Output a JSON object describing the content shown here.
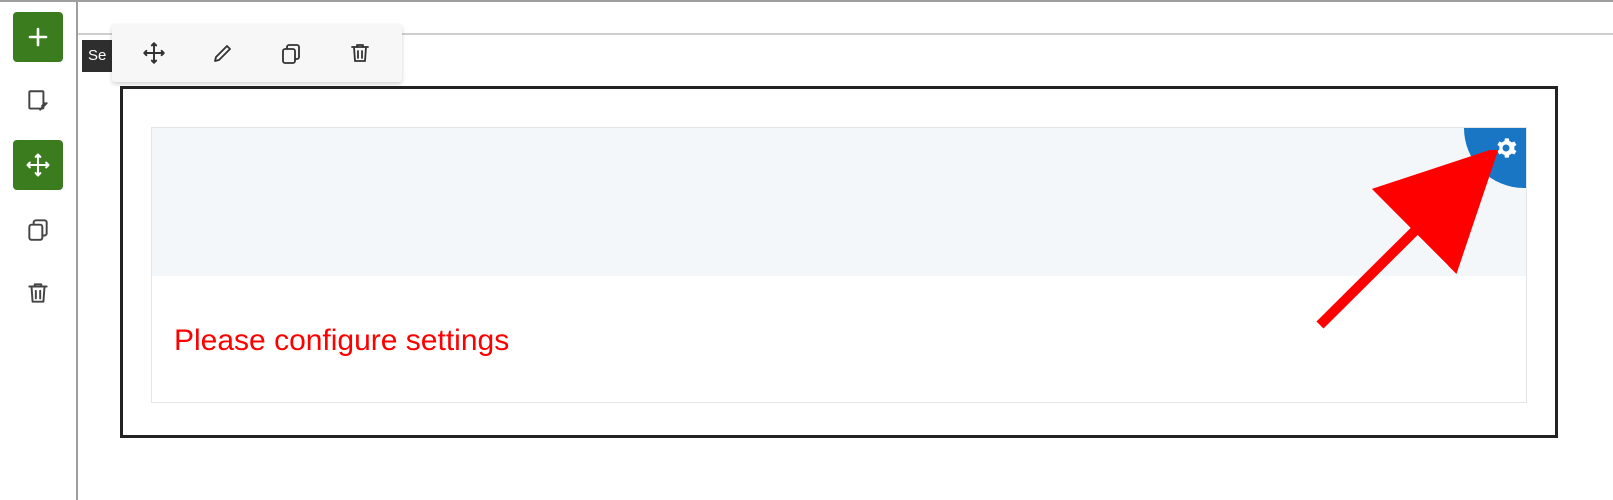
{
  "left_toolbar": {
    "add": "Add",
    "edit_form": "Edit form",
    "move": "Move",
    "copy": "Copy",
    "delete": "Delete"
  },
  "tag": {
    "label": "Se"
  },
  "floating_toolbar": {
    "move": "Move",
    "edit": "Edit",
    "copy": "Copy",
    "delete": "Delete"
  },
  "block": {
    "message": "Please configure settings",
    "gear": "Settings"
  },
  "colors": {
    "accent_green": "#3a7c1e",
    "accent_blue": "#1976c5",
    "error_red": "#ff0000"
  },
  "annotation": {
    "arrow": true
  }
}
